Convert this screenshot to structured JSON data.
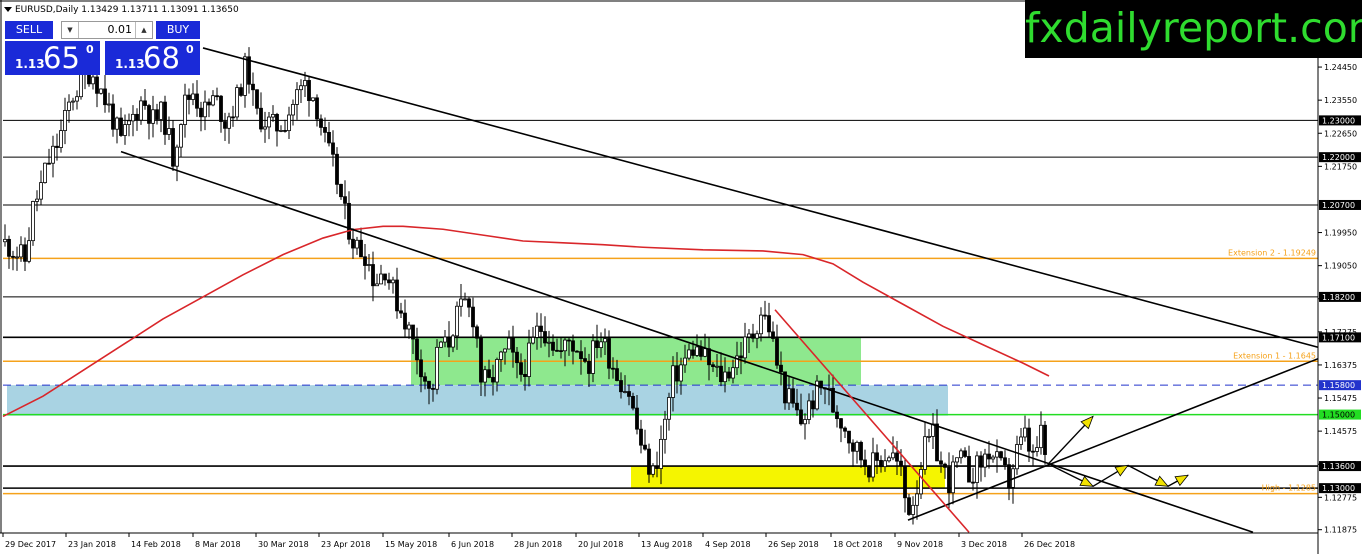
{
  "chart_title": "EURUSD,Daily  1.13429 1.13711 1.13091 1.13650",
  "trade_panel": {
    "sell_label": "SELL",
    "buy_label": "BUY",
    "lot_size": "0.01",
    "bid_prefix": "1.13",
    "bid_big": "65",
    "bid_sup": "0",
    "ask_prefix": "1.13",
    "ask_big": "68",
    "ask_sup": "0"
  },
  "brand": "fxdailyreport.com",
  "colors": {
    "candle": "#000000",
    "ma_line": "#d9262a",
    "extension_line": "#f5a21b",
    "support_green": "#22dd22",
    "dashed_blue": "#2233cc",
    "green_zone": "#8ee88e",
    "blue_zone": "#a9d3e3",
    "yellow_zone": "#f5f500",
    "forecast_arrows": "#f2e200",
    "brand_text": "#2fdc2f"
  },
  "chart_data": {
    "type": "candlestick",
    "symbol": "EURUSD",
    "timeframe": "Daily",
    "ohlc": {
      "open": 1.13429,
      "high": 1.13711,
      "low": 1.13091,
      "close": 1.1365
    },
    "y_range": [
      1.1178,
      1.2505
    ],
    "y_ticks": [
      {
        "value": 1.2445,
        "label": "1.24450"
      },
      {
        "value": 1.2355,
        "label": "1.23550"
      },
      {
        "value": 1.2265,
        "label": "1.22650"
      },
      {
        "value": 1.2175,
        "label": "1.21750"
      },
      {
        "value": 1.1995,
        "label": "1.19950"
      },
      {
        "value": 1.1905,
        "label": "1.19050"
      },
      {
        "value": 1.1815,
        "label": "1.18150"
      },
      {
        "value": 1.1725,
        "label": "1.17275"
      },
      {
        "value": 1.1635,
        "label": "1.16375"
      },
      {
        "value": 1.1545,
        "label": "1.15475"
      },
      {
        "value": 1.1455,
        "label": "1.14575"
      },
      {
        "value": 1.1365,
        "label": "1.13675"
      },
      {
        "value": 1.1275,
        "label": "1.12775"
      },
      {
        "value": 1.1187,
        "label": "1.11875"
      }
    ],
    "horizontal_levels": [
      {
        "value": 1.23,
        "label": "1.23000",
        "style": "black"
      },
      {
        "value": 1.22,
        "label": "1.22000",
        "style": "black"
      },
      {
        "value": 1.207,
        "label": "1.20700",
        "style": "black"
      },
      {
        "value": 1.182,
        "label": "1.18200",
        "style": "black"
      },
      {
        "value": 1.171,
        "label": "1.17100",
        "style": "black"
      },
      {
        "value": 1.158,
        "label": "1.15800",
        "style": "blue-dashed"
      },
      {
        "value": 1.15,
        "label": "1.15000",
        "style": "green"
      },
      {
        "value": 1.136,
        "label": "1.13600",
        "style": "black"
      },
      {
        "value": 1.13,
        "label": "1.13000",
        "style": "black"
      }
    ],
    "fib_levels": [
      {
        "value": 1.19249,
        "label": "Extension 2 - 1.19249"
      },
      {
        "value": 1.1645,
        "label": "Extension 1 - 1.1645"
      },
      {
        "value": 1.1285,
        "label": "High - 1.1285"
      }
    ],
    "x_labels": [
      "29 Dec 2017",
      "23 Jan 2018",
      "14 Feb 2018",
      "8 Mar 2018",
      "30 Mar 2018",
      "23 Apr 2018",
      "15 May 2018",
      "6 Jun 2018",
      "28 Jun 2018",
      "20 Jul 2018",
      "13 Aug 2018",
      "4 Sep 2018",
      "26 Sep 2018",
      "18 Oct 2018",
      "9 Nov 2018",
      "3 Dec 2018",
      "26 Dec 2018"
    ],
    "price_path": [
      [
        0,
        1.197
      ],
      [
        10,
        1.195
      ],
      [
        22,
        1.192
      ],
      [
        30,
        1.206
      ],
      [
        38,
        1.212
      ],
      [
        44,
        1.218
      ],
      [
        52,
        1.222
      ],
      [
        60,
        1.228
      ],
      [
        68,
        1.236
      ],
      [
        78,
        1.24
      ],
      [
        88,
        1.244
      ],
      [
        98,
        1.238
      ],
      [
        108,
        1.232
      ],
      [
        118,
        1.224
      ],
      [
        128,
        1.23
      ],
      [
        140,
        1.236
      ],
      [
        150,
        1.23
      ],
      [
        160,
        1.232
      ],
      [
        170,
        1.22
      ],
      [
        180,
        1.234
      ],
      [
        190,
        1.238
      ],
      [
        200,
        1.232
      ],
      [
        212,
        1.236
      ],
      [
        222,
        1.23
      ],
      [
        232,
        1.234
      ],
      [
        244,
        1.246
      ],
      [
        252,
        1.232
      ],
      [
        262,
        1.23
      ],
      [
        272,
        1.228
      ],
      [
        282,
        1.23
      ],
      [
        292,
        1.236
      ],
      [
        302,
        1.24
      ],
      [
        312,
        1.236
      ],
      [
        322,
        1.224
      ],
      [
        332,
        1.216
      ],
      [
        342,
        1.204
      ],
      [
        352,
        1.196
      ],
      [
        362,
        1.194
      ],
      [
        372,
        1.186
      ],
      [
        382,
        1.19
      ],
      [
        392,
        1.182
      ],
      [
        402,
        1.176
      ],
      [
        412,
        1.168
      ],
      [
        420,
        1.162
      ],
      [
        428,
        1.154
      ],
      [
        436,
        1.17
      ],
      [
        444,
        1.168
      ],
      [
        452,
        1.176
      ],
      [
        462,
        1.18
      ],
      [
        472,
        1.176
      ],
      [
        478,
        1.16
      ],
      [
        486,
        1.158
      ],
      [
        496,
        1.164
      ],
      [
        506,
        1.168
      ],
      [
        516,
        1.16
      ],
      [
        526,
        1.166
      ],
      [
        536,
        1.174
      ],
      [
        546,
        1.172
      ],
      [
        556,
        1.166
      ],
      [
        566,
        1.17
      ],
      [
        576,
        1.168
      ],
      [
        586,
        1.164
      ],
      [
        596,
        1.172
      ],
      [
        606,
        1.166
      ],
      [
        616,
        1.16
      ],
      [
        626,
        1.156
      ],
      [
        634,
        1.146
      ],
      [
        642,
        1.138
      ],
      [
        650,
        1.134
      ],
      [
        656,
        1.14
      ],
      [
        662,
        1.148
      ],
      [
        670,
        1.16
      ],
      [
        680,
        1.164
      ],
      [
        690,
        1.168
      ],
      [
        700,
        1.166
      ],
      [
        710,
        1.162
      ],
      [
        720,
        1.16
      ],
      [
        730,
        1.164
      ],
      [
        740,
        1.168
      ],
      [
        750,
        1.172
      ],
      [
        758,
        1.178
      ],
      [
        766,
        1.174
      ],
      [
        774,
        1.164
      ],
      [
        782,
        1.156
      ],
      [
        790,
        1.152
      ],
      [
        798,
        1.148
      ],
      [
        806,
        1.152
      ],
      [
        814,
        1.156
      ],
      [
        822,
        1.158
      ],
      [
        830,
        1.152
      ],
      [
        840,
        1.148
      ],
      [
        850,
        1.142
      ],
      [
        860,
        1.138
      ],
      [
        868,
        1.136
      ],
      [
        878,
        1.138
      ],
      [
        888,
        1.14
      ],
      [
        898,
        1.134
      ],
      [
        904,
        1.124
      ],
      [
        912,
        1.128
      ],
      [
        920,
        1.14
      ],
      [
        930,
        1.144
      ],
      [
        938,
        1.136
      ],
      [
        946,
        1.132
      ],
      [
        956,
        1.138
      ],
      [
        966,
        1.134
      ],
      [
        976,
        1.136
      ],
      [
        986,
        1.14
      ],
      [
        996,
        1.136
      ],
      [
        1006,
        1.132
      ],
      [
        1014,
        1.14
      ],
      [
        1022,
        1.144
      ],
      [
        1030,
        1.138
      ],
      [
        1038,
        1.144
      ],
      [
        1044,
        1.1365
      ]
    ],
    "ma_path": [
      [
        0,
        1.1495
      ],
      [
        40,
        1.155
      ],
      [
        80,
        1.162
      ],
      [
        120,
        1.169
      ],
      [
        160,
        1.176
      ],
      [
        200,
        1.182
      ],
      [
        240,
        1.188
      ],
      [
        280,
        1.1935
      ],
      [
        320,
        1.198
      ],
      [
        350,
        1.2003
      ],
      [
        380,
        1.2012
      ],
      [
        400,
        1.2012
      ],
      [
        440,
        1.2004
      ],
      [
        480,
        1.1988
      ],
      [
        520,
        1.1972
      ],
      [
        560,
        1.1967
      ],
      [
        600,
        1.1962
      ],
      [
        640,
        1.1955
      ],
      [
        700,
        1.1948
      ],
      [
        760,
        1.1945
      ],
      [
        800,
        1.1935
      ],
      [
        830,
        1.191
      ],
      [
        860,
        1.186
      ],
      [
        900,
        1.18
      ],
      [
        940,
        1.174
      ],
      [
        980,
        1.169
      ],
      [
        1020,
        1.164
      ],
      [
        1046,
        1.1605
      ]
    ],
    "trendlines": [
      {
        "from": [
          200,
          1.2497
        ],
        "to": [
          1315,
          1.1683
        ],
        "style": "black"
      },
      {
        "from": [
          118,
          1.2215
        ],
        "to": [
          1250,
          1.118
        ],
        "style": "black"
      },
      {
        "from": [
          905,
          1.1213
        ],
        "to": [
          1315,
          1.1652
        ],
        "style": "black"
      },
      {
        "from": [
          772,
          1.1785
        ],
        "to": [
          966,
          1.118
        ],
        "style": "red"
      }
    ],
    "zones": [
      {
        "from": [
          408,
          1.171
        ],
        "to": [
          858,
          1.158
        ],
        "color": "green"
      },
      {
        "from": [
          4,
          1.158
        ],
        "to": [
          945,
          1.1497
        ],
        "color": "blue"
      },
      {
        "from": [
          628,
          1.136
        ],
        "to": [
          942,
          1.13
        ],
        "color": "yellow"
      }
    ],
    "forecast_arrows": [
      {
        "from": [
          1045,
          1.1365
        ],
        "to": [
          1090,
          1.1495
        ]
      },
      {
        "from": [
          1048,
          1.1362
        ],
        "to": [
          1090,
          1.1305
        ]
      },
      {
        "from": [
          1090,
          1.1305
        ],
        "to": [
          1125,
          1.1362
        ]
      },
      {
        "from": [
          1125,
          1.1362
        ],
        "to": [
          1165,
          1.1305
        ]
      },
      {
        "from": [
          1165,
          1.1305
        ],
        "to": [
          1185,
          1.1335
        ]
      }
    ]
  }
}
